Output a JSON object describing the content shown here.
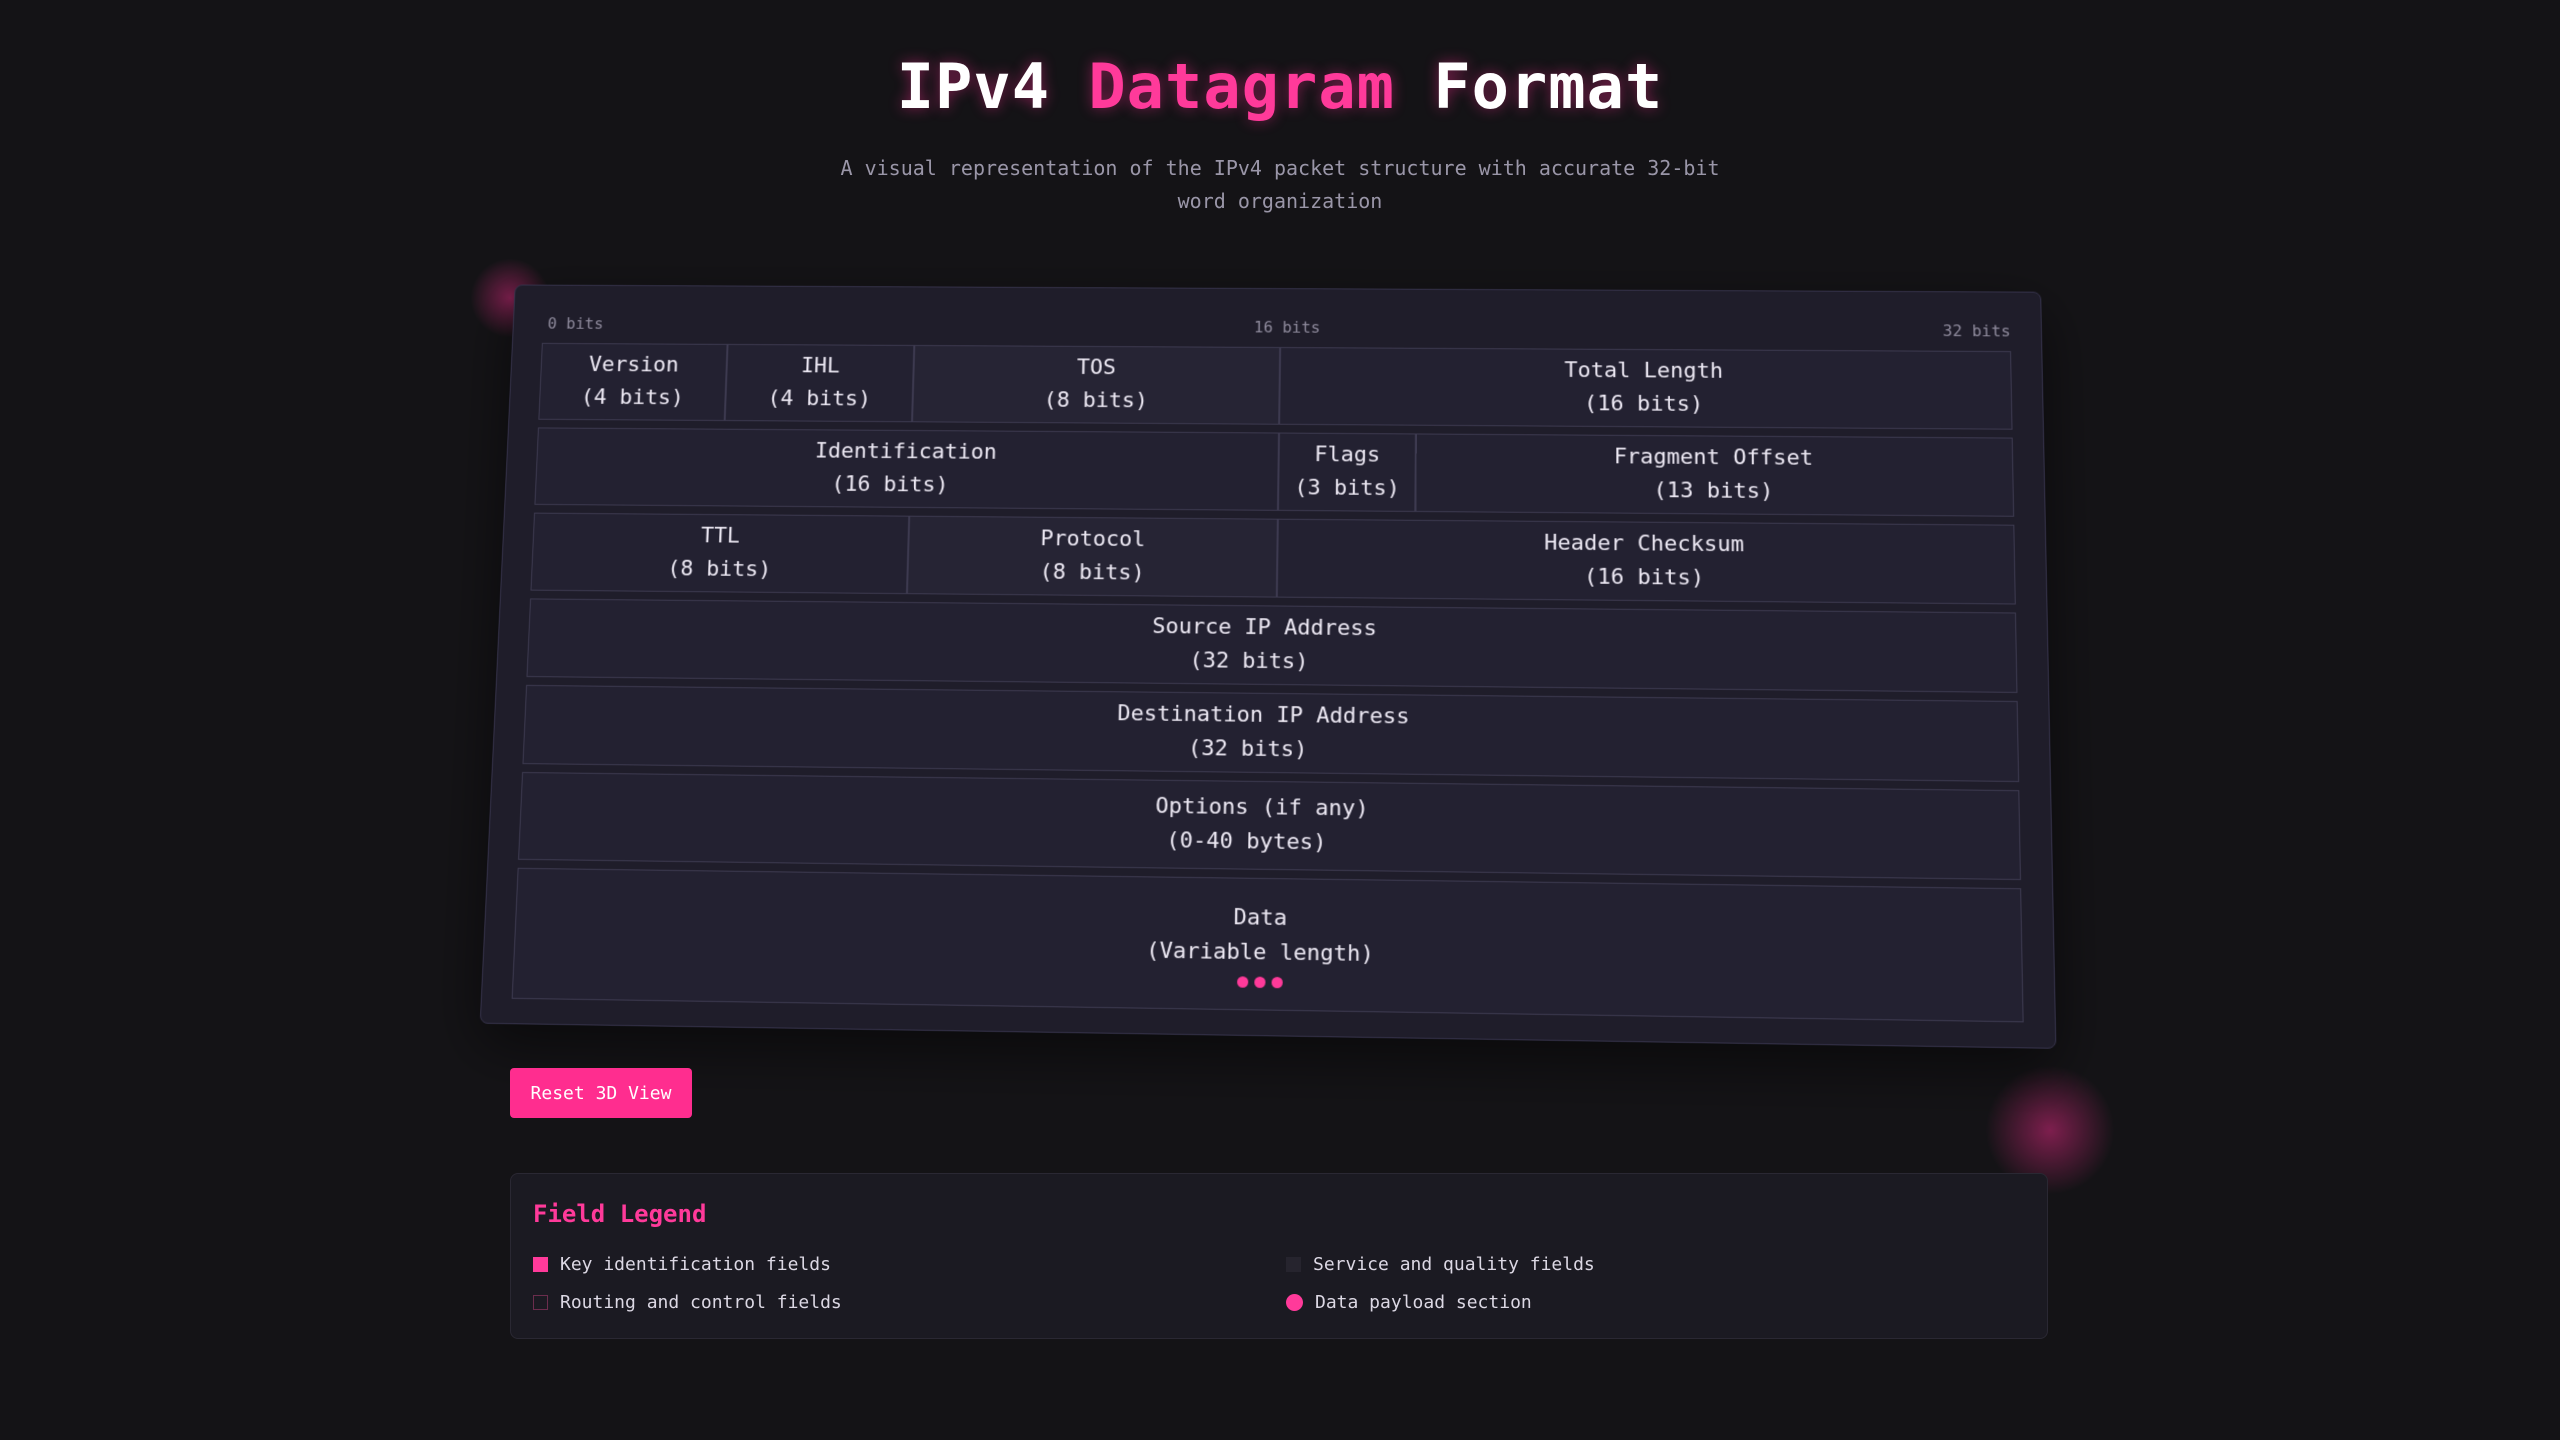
{
  "header": {
    "title_part1": "IPv4",
    "title_part2": "Datagram",
    "title_part3": "Format",
    "subtitle": "A visual representation of the IPv4 packet structure with accurate 32-bit word organization"
  },
  "diagram": {
    "bit_markers": [
      "0 bits",
      "16 bits",
      "32 bits"
    ],
    "rows": [
      [
        {
          "name": "Version",
          "size": "(4 bits)"
        },
        {
          "name": "IHL",
          "size": "(4 bits)"
        },
        {
          "name": "TOS",
          "size": "(8 bits)"
        },
        {
          "name": "Total Length",
          "size": "(16 bits)"
        }
      ],
      [
        {
          "name": "Identification",
          "size": "(16 bits)"
        },
        {
          "name": "Flags",
          "size": "(3 bits)"
        },
        {
          "name": "Fragment Offset",
          "size": "(13 bits)"
        }
      ],
      [
        {
          "name": "TTL",
          "size": "(8 bits)"
        },
        {
          "name": "Protocol",
          "size": "(8 bits)"
        },
        {
          "name": "Header Checksum",
          "size": "(16 bits)"
        }
      ],
      [
        {
          "name": "Source IP Address",
          "size": "(32 bits)"
        }
      ],
      [
        {
          "name": "Destination IP Address",
          "size": "(32 bits)"
        }
      ],
      [
        {
          "name": "Options (if any)",
          "size": "(0-40 bytes)"
        }
      ],
      [
        {
          "name": "Data",
          "size": "(Variable length)"
        }
      ]
    ]
  },
  "controls": {
    "reset_label": "Reset 3D View"
  },
  "legend": {
    "title": "Field Legend",
    "items": [
      {
        "label": "Key identification fields",
        "color": "#ff3a9a"
      },
      {
        "label": "Service and quality fields",
        "color": "#26242e"
      },
      {
        "label": "Routing and control fields",
        "color": "#6b2d4d"
      },
      {
        "label": "Data payload section",
        "color": "#ff3a9a"
      }
    ]
  },
  "colors": {
    "accent": "#ff3a9a",
    "background": "#141316",
    "panel": "#1f1d2a"
  }
}
